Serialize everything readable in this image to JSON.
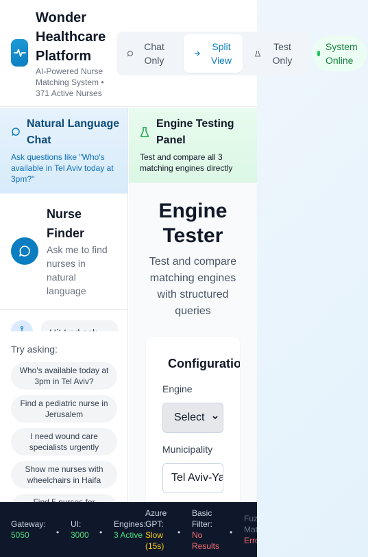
{
  "header": {
    "title": "Wonder Healthcare Platform",
    "subtitle": "AI-Powered Nurse Matching System • 371 Active Nurses",
    "modes": [
      {
        "label": "Chat Only",
        "active": false
      },
      {
        "label": "Split View",
        "active": true
      },
      {
        "label": "Test Only",
        "active": false
      }
    ],
    "status": "System Online"
  },
  "chat_panel": {
    "title": "Natural Language Chat",
    "description": "Ask questions like \"Who's available in Tel Aviv today at 3pm?\""
  },
  "nurse_finder": {
    "title": "Nurse Finder",
    "description": "Ask me to find nurses in natural language",
    "message_preview": "Hi! I nd ask..."
  },
  "suggestions": {
    "heading": "Try asking:",
    "items": [
      "Who's available today at 3pm in Tel Aviv?",
      "Find a pediatric nurse in Jerusalem",
      "I need wound care specialists urgently",
      "Show me nurses with wheelchairs in Haifa",
      "Find 5 nurses for"
    ]
  },
  "engine_panel": {
    "title": "Engine Testing Panel",
    "description": "Test and compare all 3 matching engines directly"
  },
  "tester": {
    "title": "Engine Tester",
    "subtitle": "Test and compare matching engines with structured queries",
    "config_title": "Configuration",
    "engine_label": "Engine",
    "engine_value": "Select",
    "municipality_label": "Municipality",
    "municipality_value": "Tel Aviv-Yafo"
  },
  "footer": {
    "gateway_label": "Gateway:",
    "gateway_value": "5050",
    "ui_label": "UI:",
    "ui_value": "3000",
    "engines_label": "Engines:",
    "engines_value": "3 Active",
    "azure_label": "Azure GPT:",
    "azure_value": "Slow (15s)",
    "basic_label": "Basic Filter:",
    "basic_value": "No Results",
    "fuzzy_label": "Fuzzy Match:",
    "fuzzy_value": "Error",
    "separator": "•"
  },
  "colors": {
    "brand": "#0b7dc0",
    "online": "#22c55e",
    "ok": "#4ade80",
    "warn": "#facc15",
    "error": "#f87171"
  }
}
